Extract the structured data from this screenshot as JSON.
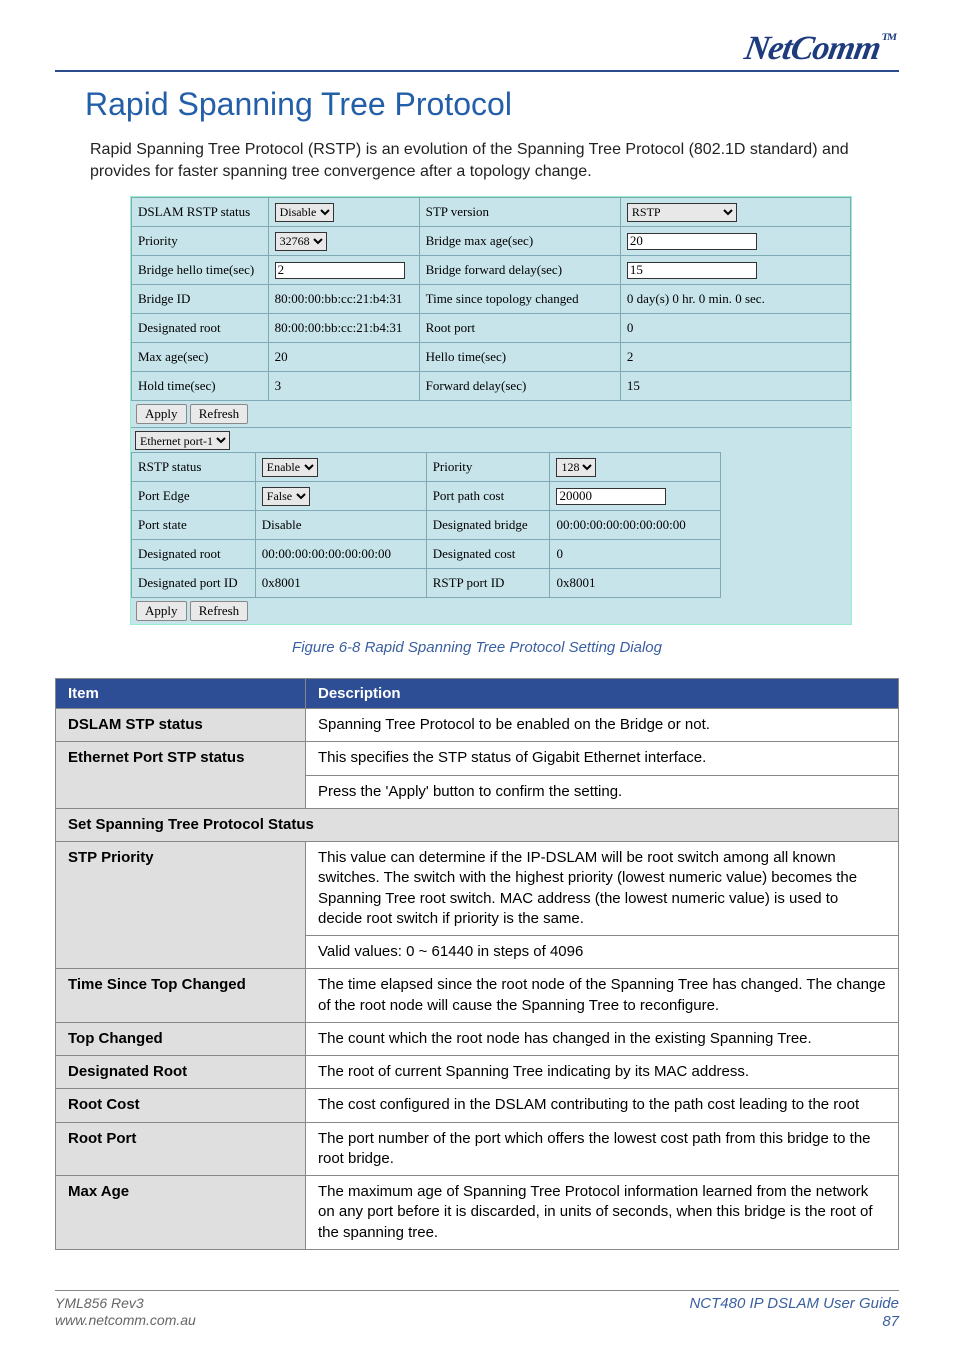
{
  "brand": {
    "name": "NetComm",
    "tm": "TM"
  },
  "heading": "Rapid Spanning Tree Protocol",
  "intro": "Rapid Spanning Tree Protocol (RSTP) is an evolution of the Spanning Tree Protocol (802.1D standard) and provides for faster spanning tree convergence after a topology change.",
  "dialog": {
    "top": {
      "dslam_rstp_status_label": "DSLAM RSTP status",
      "dslam_rstp_status_value": "Disable",
      "stp_version_label": "STP version",
      "stp_version_value": "RSTP",
      "priority_label": "Priority",
      "priority_value": "32768",
      "bridge_max_age_label": "Bridge max age(sec)",
      "bridge_max_age_value": "20",
      "bridge_hello_label": "Bridge hello time(sec)",
      "bridge_hello_value": "2",
      "bridge_fwd_label": "Bridge forward delay(sec)",
      "bridge_fwd_value": "15",
      "bridge_id_label": "Bridge ID",
      "bridge_id_value": "80:00:00:bb:cc:21:b4:31",
      "time_since_label": "Time since topology changed",
      "time_since_value": "0 day(s) 0 hr. 0 min. 0 sec.",
      "designated_root_label": "Designated root",
      "designated_root_value": "80:00:00:bb:cc:21:b4:31",
      "root_port_label": "Root port",
      "root_port_value": "0",
      "max_age_label": "Max age(sec)",
      "max_age_value": "20",
      "hello_time_label": "Hello time(sec)",
      "hello_time_value": "2",
      "hold_time_label": "Hold time(sec)",
      "hold_time_value": "3",
      "forward_delay_label": "Forward delay(sec)",
      "forward_delay_value": "15"
    },
    "port_select_value": "Ethernet port-1",
    "port": {
      "rstp_status_label": "RSTP status",
      "rstp_status_value": "Enable",
      "priority_label": "Priority",
      "priority_value": "128",
      "port_edge_label": "Port Edge",
      "port_edge_value": "False",
      "port_path_cost_label": "Port path cost",
      "port_path_cost_value": "20000",
      "port_state_label": "Port state",
      "port_state_value": "Disable",
      "designated_bridge_label": "Designated bridge",
      "designated_bridge_value": "00:00:00:00:00:00:00:00",
      "designated_root_label": "Designated root",
      "designated_root_value": "00:00:00:00:00:00:00:00",
      "designated_cost_label": "Designated cost",
      "designated_cost_value": "0",
      "designated_port_id_label": "Designated port ID",
      "designated_port_id_value": "0x8001",
      "rstp_port_id_label": "RSTP port ID",
      "rstp_port_id_value": "0x8001"
    },
    "buttons": {
      "apply": "Apply",
      "refresh": "Refresh"
    }
  },
  "caption": "Figure 6-8 Rapid Spanning Tree Protocol Setting Dialog",
  "desc": {
    "headers": {
      "item": "Item",
      "description": "Description"
    },
    "rows": [
      {
        "item": "DSLAM STP status",
        "desc": "Spanning Tree Protocol to be enabled on the Bridge or not."
      },
      {
        "item": "Ethernet Port STP status",
        "desc": "This specifies the STP status of Gigabit Ethernet interface.",
        "desc2": "Press the 'Apply' button to confirm the setting."
      },
      {
        "section": "Set Spanning Tree Protocol Status"
      },
      {
        "item": "STP Priority",
        "desc": "This value can determine if the IP-DSLAM will be root switch among all known switches. The switch with the highest priority (lowest numeric value) becomes the Spanning Tree root switch. MAC address (the lowest numeric value) is used to decide root switch if priority is the same.",
        "desc2": "Valid values: 0 ~ 61440 in steps of 4096"
      },
      {
        "item": "Time Since Top Changed",
        "desc": "The time elapsed since the root node of the Spanning Tree has changed. The change of the root node will cause the Spanning Tree to reconfigure."
      },
      {
        "item": "Top Changed",
        "desc": "The count which the root node has changed in the existing Spanning Tree."
      },
      {
        "item": "Designated Root",
        "desc": "The root of current Spanning Tree indicating by its MAC address."
      },
      {
        "item": "Root Cost",
        "desc": "The cost configured in the DSLAM contributing to the path cost leading to the root"
      },
      {
        "item": "Root Port",
        "desc": "The port number of the port which offers the lowest cost path from this bridge to the root bridge."
      },
      {
        "item": "Max Age",
        "desc": "The maximum age of Spanning Tree Protocol information learned from the network on any port before it is discarded, in units of seconds, when this bridge is the root of the spanning tree."
      }
    ]
  },
  "footer": {
    "rev": "YML856 Rev3",
    "url": "www.netcomm.com.au",
    "guide": "NCT480 IP DSLAM User Guide",
    "page": "87"
  }
}
